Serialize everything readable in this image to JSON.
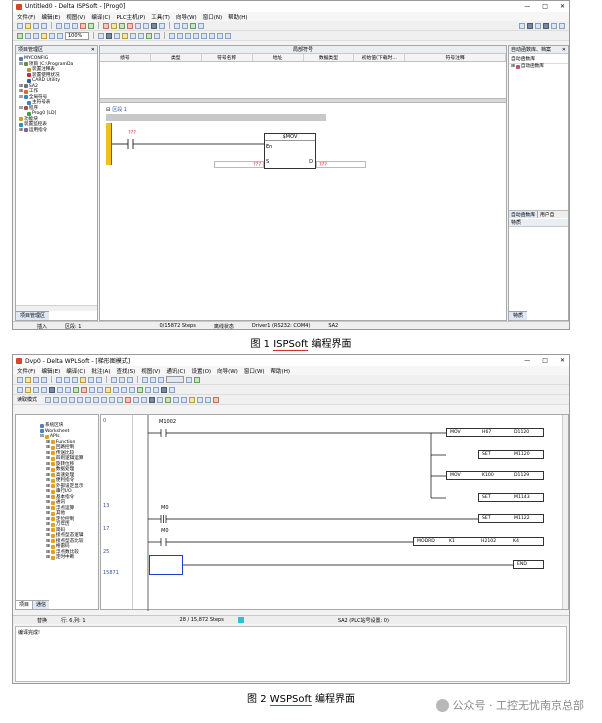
{
  "fig1": {
    "title": "Untitled0 - Delta ISPSoft - [Prog0]",
    "menu": [
      "文件(F)",
      "编辑(E)",
      "视图(V)",
      "编译(C)",
      "PLC主机(P)",
      "工具(T)",
      "向导(W)",
      "窗口(N)",
      "帮助(H)"
    ],
    "zoom": "100%",
    "project_panel": {
      "title": "项目管理区",
      "items": [
        "MYCONFIG",
        "项目 (C:\\ProgramDa",
        "装置注释表",
        "装置使用状况",
        "CARD Utility",
        "SA2",
        "工作",
        "全局符号",
        "主符号表",
        "程序",
        "Prog0 [LD]",
        "功能块",
        "装置监控表",
        "运用指令"
      ],
      "tab": "项目管理区"
    },
    "symbol_table": {
      "title": "局部符号",
      "columns": [
        "绩号",
        "类型",
        "符号名称",
        "地址",
        "数据类型",
        "初始值(下载时...",
        "符号注释"
      ]
    },
    "ladder": {
      "rung_label": "区段 1",
      "contact_label": "???",
      "block_name": "$MOV",
      "pin_en": "En",
      "pin_s": "S",
      "pin_d": "D",
      "s_value": "???",
      "d_value": "???"
    },
    "right_panel": {
      "title": "自动函数库、档案",
      "tree_root": "自动函数库",
      "tree_item": "自动函数库",
      "tab1": "自动函数库",
      "tab2": "用户自",
      "lower_title": "特质",
      "lower_tab": "特质"
    },
    "status": {
      "mode": "插入",
      "section": "区段: 1",
      "steps": "0/15872 Steps",
      "conn": "离线状态",
      "driver": "Driver1 (RS232: COM4)",
      "model": "SA2"
    },
    "caption_prefix": "图  1 ",
    "caption_name": "ISPSoft",
    "caption_suffix": " 编程界面"
  },
  "fig2": {
    "title": "Dvp0 - Delta WPLSoft - [梯形图模式]",
    "menu": [
      "文件(F)",
      "编辑(E)",
      "编译(C)",
      "批注(A)",
      "查找(S)",
      "视图(V)",
      "通讯(C)",
      "设置(O)",
      "向导(W)",
      "窗口(W)",
      "帮助(H)"
    ],
    "mode_label": "读取模式",
    "tree_items": [
      "系统区块",
      "Worksheet",
      "APIs",
      "Function",
      "回路控制",
      "传送比较",
      "四则逻辑运算",
      "旋转位移",
      "数据处理",
      "高速处理",
      "便利指令",
      "外部设定显示",
      "串行I/O",
      "基本指令",
      "通讯",
      "浮点运算",
      "其他",
      "定位控制",
      "万年历",
      "简码",
      "接点型态逻辑",
      "接点型态比较",
      "格雷码",
      "浮点数比较",
      "定时中断"
    ],
    "panel_tabs": [
      "项目",
      "通信"
    ],
    "rungs": [
      {
        "step": "0",
        "contact": "M1002",
        "rows": [
          {
            "op": "MOV",
            "a": "H67",
            "b": "D1120"
          },
          {
            "op": "SET",
            "a": "",
            "b": "M1120"
          },
          {
            "op": "MOV",
            "a": "K100",
            "b": "D1129"
          },
          {
            "op": "SET",
            "a": "",
            "b": "M1143"
          }
        ]
      },
      {
        "step": "13",
        "contact": "M0",
        "rows": [
          {
            "op": "SET",
            "a": "",
            "b": "M1122"
          }
        ]
      },
      {
        "step": "17",
        "contact": "M0",
        "rows": [
          {
            "op": "MODRD",
            "a": "K1",
            "b": "H2102",
            "c": "K4"
          }
        ]
      },
      {
        "step": "25",
        "contact": "",
        "rows": [
          {
            "op": "END",
            "a": "",
            "b": ""
          }
        ]
      }
    ],
    "end_step": "15871",
    "status": {
      "mode": "替换",
      "pos": "行: 6,列: 1",
      "steps": "28 / 15,872 Steps",
      "model": "SA2 (PLC站号设置: 0)"
    },
    "output_text": "编译完成!",
    "caption_prefix": "图  2 ",
    "caption_name": "WSPSoft",
    "caption_suffix": " 编程界面"
  },
  "watermark": "公众号 · 工控无忧南京总部"
}
